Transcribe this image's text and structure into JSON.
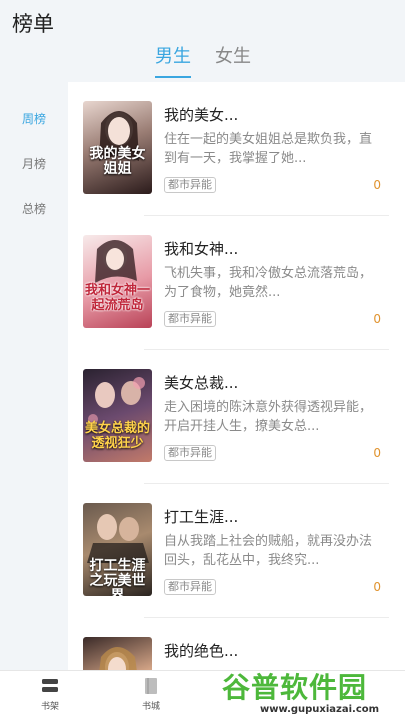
{
  "header": {
    "title": "榜单"
  },
  "gender_tabs": [
    {
      "label": "男生",
      "active": true
    },
    {
      "label": "女生",
      "active": false
    }
  ],
  "sidebar": {
    "items": [
      {
        "label": "周榜",
        "active": true
      },
      {
        "label": "月榜",
        "active": false
      },
      {
        "label": "总榜",
        "active": false
      }
    ]
  },
  "books": [
    {
      "title": "我的美女...",
      "desc": "住在一起的美女姐姐总是欺负我，直到有一天，我掌握了她...",
      "tag": "都市异能",
      "count": "0",
      "cover_text": "我的美女姐姐",
      "cover_sub": "",
      "cover_colors": [
        "#5a4a4a",
        "#e8d6cf",
        "#2b1b1b"
      ]
    },
    {
      "title": "我和女神...",
      "desc": "飞机失事，我和冷傲女总流落荒岛，为了食物，她竟然...",
      "tag": "都市异能",
      "count": "0",
      "cover_text": "我和女神一起流荒岛",
      "cover_sub": "",
      "cover_colors": [
        "#f3dede",
        "#e79aa6",
        "#b94257"
      ]
    },
    {
      "title": "美女总裁...",
      "desc": "走入困境的陈沐意外获得透视异能，开启开挂人生，撩美女总...",
      "tag": "都市异能",
      "count": "0",
      "cover_text": "美女总裁的透视狂少",
      "cover_sub": "",
      "cover_colors": [
        "#2a2230",
        "#6b4a6e",
        "#c27a6a"
      ]
    },
    {
      "title": "打工生涯...",
      "desc": "自从我踏上社会的贼船，就再没办法回头，乱花丛中，我终究...",
      "tag": "都市异能",
      "count": "0",
      "cover_text": "打工生涯之玩美世界",
      "cover_sub": "",
      "cover_colors": [
        "#3d3a36",
        "#a88a6e",
        "#2a2420"
      ]
    },
    {
      "title": "我的绝色...",
      "desc": "",
      "tag": "",
      "count": "",
      "cover_text": "",
      "cover_sub": "",
      "cover_colors": [
        "#3a2a28",
        "#d9a98a",
        "#6a3a30"
      ]
    }
  ],
  "bottom_nav": [
    {
      "label": "书架",
      "icon": "bookshelf-icon"
    },
    {
      "label": "书城",
      "icon": "bookstore-icon"
    }
  ],
  "watermark": {
    "main": "谷普软件园",
    "url": "www.gupuxiazai.com"
  },
  "colors": {
    "accent": "#3aa6e0",
    "count": "#e0932e",
    "watermark": "#4db83b"
  }
}
